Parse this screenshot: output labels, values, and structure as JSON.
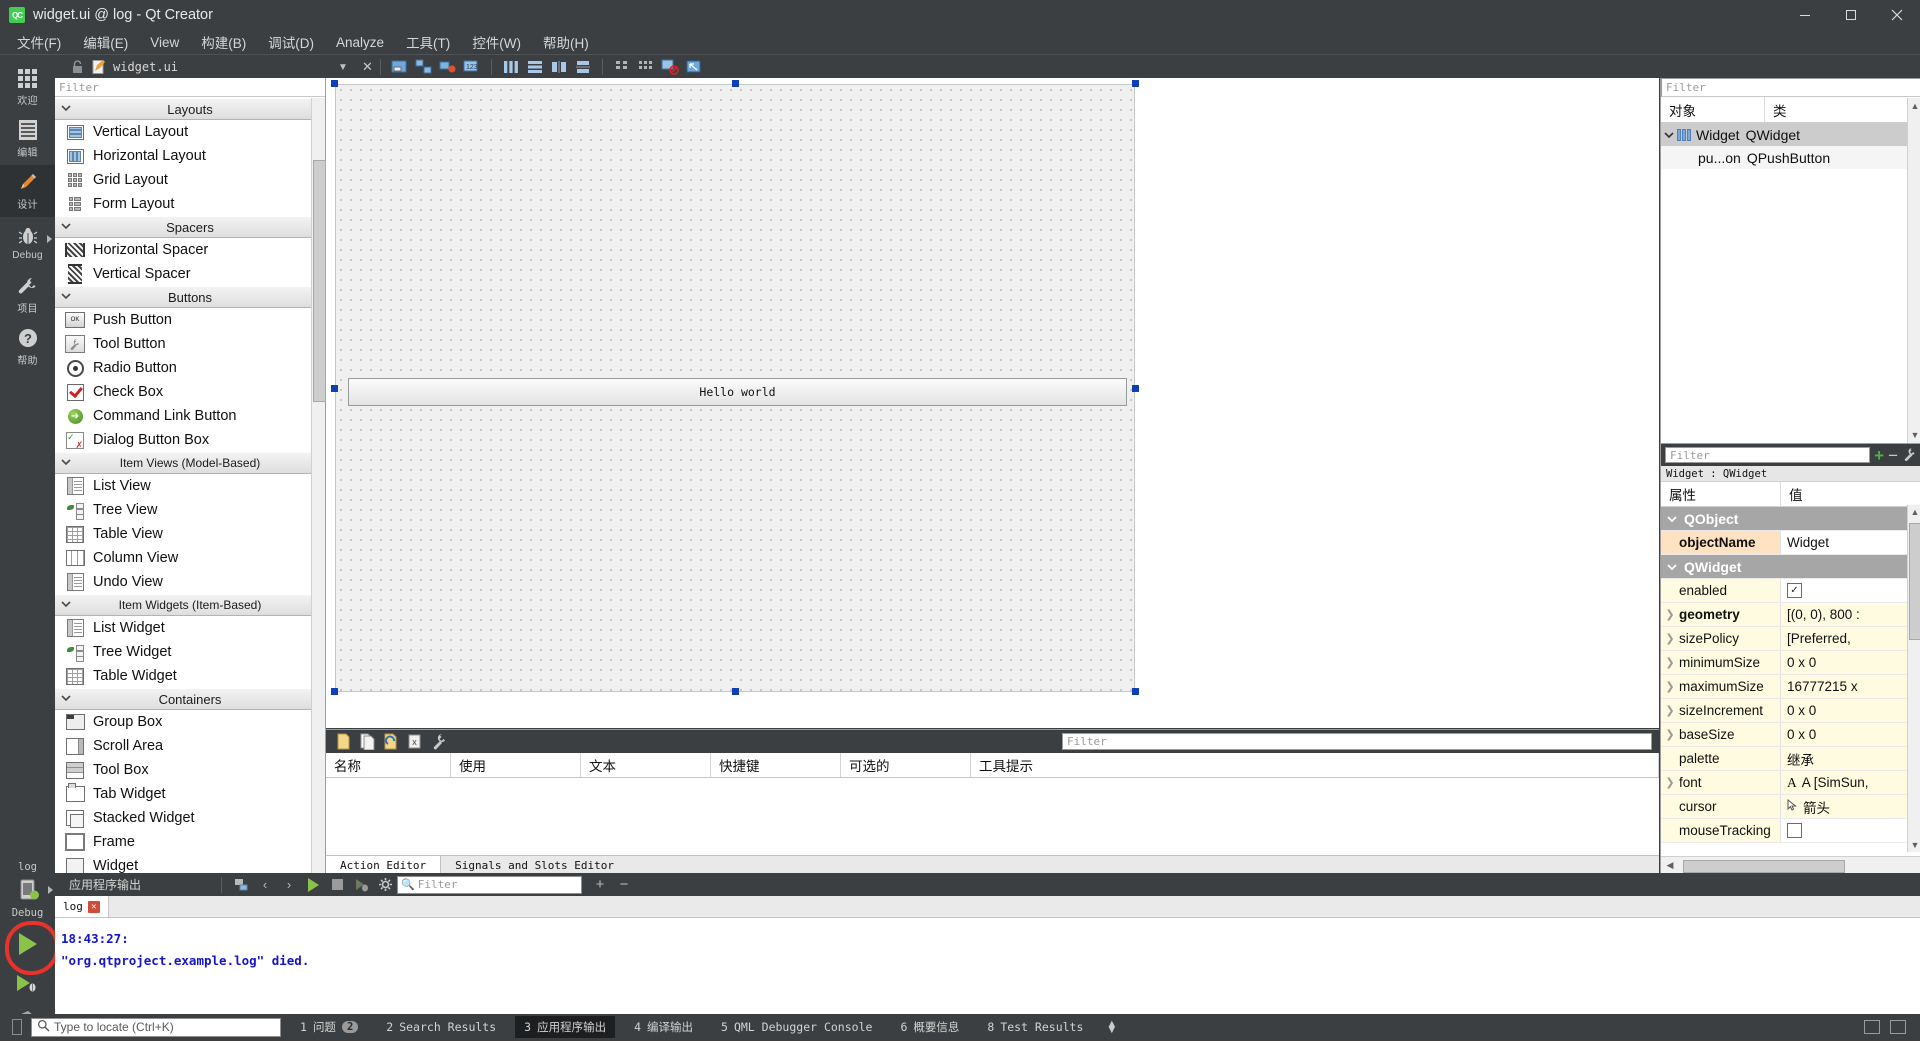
{
  "window": {
    "title": "widget.ui @ log - Qt Creator",
    "app_icon": "qt-creator-icon",
    "minimize": "—",
    "maximize": "❐",
    "close": "✕"
  },
  "menubar": [
    {
      "label": "文件(F)"
    },
    {
      "label": "编辑(E)"
    },
    {
      "label": "View"
    },
    {
      "label": "构建(B)"
    },
    {
      "label": "调试(D)"
    },
    {
      "label": "Analyze"
    },
    {
      "label": "工具(T)"
    },
    {
      "label": "控件(W)"
    },
    {
      "label": "帮助(H)"
    }
  ],
  "modebar": [
    {
      "label": "欢迎",
      "icon": "grid-icon"
    },
    {
      "label": "编辑",
      "icon": "document-icon"
    },
    {
      "label": "设计",
      "icon": "pencil-icon",
      "selected": true
    },
    {
      "label": "Debug",
      "icon": "bug-icon"
    },
    {
      "label": "项目",
      "icon": "wrench-icon"
    },
    {
      "label": "帮助",
      "icon": "question-icon"
    }
  ],
  "runbar": {
    "kit_label": "log",
    "device_label": "Debug",
    "run_button": "run-icon",
    "debug_button": "debug-run-icon",
    "build_button": "hammer-icon"
  },
  "form_toolbar": {
    "file_name": "widget.ui",
    "lock_icon": "lock-icon",
    "file_icon": "ui-file-icon",
    "dropdown_icon": "chevron-down-icon",
    "close_icon": "close-icon",
    "tools": [
      "edit-widgets-icon",
      "edit-signals-slots-icon",
      "edit-buddies-icon",
      "edit-tab-order-icon",
      "layout-horizontally-icon",
      "layout-vertically-icon",
      "layout-splitter-h-icon",
      "layout-splitter-v-icon",
      "layout-form-icon",
      "layout-grid-icon",
      "break-layout-icon",
      "adjust-size-icon"
    ]
  },
  "widget_box": {
    "filter_placeholder": "Filter",
    "groups": [
      {
        "title": "Layouts",
        "items": [
          {
            "label": "Vertical Layout",
            "icon": "vertical-layout-icon"
          },
          {
            "label": "Horizontal Layout",
            "icon": "horizontal-layout-icon"
          },
          {
            "label": "Grid Layout",
            "icon": "grid-layout-icon"
          },
          {
            "label": "Form Layout",
            "icon": "form-layout-icon"
          }
        ]
      },
      {
        "title": "Spacers",
        "items": [
          {
            "label": "Horizontal Spacer",
            "icon": "horizontal-spacer-icon"
          },
          {
            "label": "Vertical Spacer",
            "icon": "vertical-spacer-icon"
          }
        ]
      },
      {
        "title": "Buttons",
        "items": [
          {
            "label": "Push Button",
            "icon": "push-button-icon"
          },
          {
            "label": "Tool Button",
            "icon": "tool-button-icon"
          },
          {
            "label": "Radio Button",
            "icon": "radio-button-icon"
          },
          {
            "label": "Check Box",
            "icon": "check-box-icon"
          },
          {
            "label": "Command Link Button",
            "icon": "command-link-button-icon"
          },
          {
            "label": "Dialog Button Box",
            "icon": "dialog-button-box-icon"
          }
        ]
      },
      {
        "title": "Item Views (Model-Based)",
        "items": [
          {
            "label": "List View",
            "icon": "list-view-icon"
          },
          {
            "label": "Tree View",
            "icon": "tree-view-icon"
          },
          {
            "label": "Table View",
            "icon": "table-view-icon"
          },
          {
            "label": "Column View",
            "icon": "column-view-icon"
          },
          {
            "label": "Undo View",
            "icon": "undo-view-icon"
          }
        ]
      },
      {
        "title": "Item Widgets (Item-Based)",
        "items": [
          {
            "label": "List Widget",
            "icon": "list-widget-icon"
          },
          {
            "label": "Tree Widget",
            "icon": "tree-widget-icon"
          },
          {
            "label": "Table Widget",
            "icon": "table-widget-icon"
          }
        ]
      },
      {
        "title": "Containers",
        "items": [
          {
            "label": "Group Box",
            "icon": "group-box-icon"
          },
          {
            "label": "Scroll Area",
            "icon": "scroll-area-icon"
          },
          {
            "label": "Tool Box",
            "icon": "tool-box-icon"
          },
          {
            "label": "Tab Widget",
            "icon": "tab-widget-icon"
          },
          {
            "label": "Stacked Widget",
            "icon": "stacked-widget-icon"
          },
          {
            "label": "Frame",
            "icon": "frame-icon"
          },
          {
            "label": "Widget",
            "icon": "widget-icon"
          }
        ]
      }
    ]
  },
  "canvas": {
    "button_text": "Hello world"
  },
  "action_editor": {
    "toolbar_icons": [
      "new-action-icon",
      "copy-action-icon",
      "edit-action-icon",
      "delete-action-icon",
      "configure-icon"
    ],
    "filter_placeholder": "Filter",
    "columns": [
      "名称",
      "使用",
      "文本",
      "快捷键",
      "可选的",
      "工具提示"
    ],
    "tabs": [
      {
        "label": "Action Editor",
        "selected": true
      },
      {
        "label": "Signals and Slots Editor",
        "selected": false
      }
    ]
  },
  "object_inspector": {
    "filter_placeholder": "Filter",
    "columns": [
      "对象",
      "类"
    ],
    "rows": [
      {
        "object": "Widget",
        "class": "QWidget",
        "selected": true,
        "expanded": true,
        "depth": 0,
        "icon": "widget-icon"
      },
      {
        "object": "pu...on",
        "class": "QPushButton",
        "selected": false,
        "expanded": false,
        "depth": 1,
        "icon": ""
      }
    ]
  },
  "property_editor": {
    "filter_placeholder": "Filter",
    "add_icon": "plus-icon",
    "remove_icon": "minus-icon",
    "configure_icon": "wrench-icon",
    "subject": "Widget : QWidget",
    "columns": [
      "属性",
      "值"
    ],
    "rows": [
      {
        "kind": "group",
        "name": "QObject"
      },
      {
        "kind": "prop",
        "name": "objectName",
        "value": "Widget",
        "bold": true,
        "highlight": true,
        "expandable": false
      },
      {
        "kind": "group",
        "name": "QWidget"
      },
      {
        "kind": "prop",
        "name": "enabled",
        "value": "",
        "checkbox": true,
        "checked": true,
        "expandable": false
      },
      {
        "kind": "prop",
        "name": "geometry",
        "value": "[(0, 0), 800 :",
        "bold": true,
        "expandable": true
      },
      {
        "kind": "prop",
        "name": "sizePolicy",
        "value": "[Preferred,",
        "expandable": true
      },
      {
        "kind": "prop",
        "name": "minimumSize",
        "value": "0 x 0",
        "expandable": true
      },
      {
        "kind": "prop",
        "name": "maximumSize",
        "value": "16777215 x",
        "expandable": true
      },
      {
        "kind": "prop",
        "name": "sizeIncrement",
        "value": "0 x 0",
        "expandable": true
      },
      {
        "kind": "prop",
        "name": "baseSize",
        "value": "0 x 0",
        "expandable": true
      },
      {
        "kind": "prop",
        "name": "palette",
        "value": "继承",
        "expandable": false
      },
      {
        "kind": "prop",
        "name": "font",
        "value": "A  [SimSun,",
        "expandable": true
      },
      {
        "kind": "prop",
        "name": "cursor",
        "value": "箭头",
        "expandable": false
      },
      {
        "kind": "prop",
        "name": "mouseTracking",
        "value": "",
        "checkbox": true,
        "checked": false,
        "expandable": false
      }
    ]
  },
  "output_pane": {
    "title": "应用程序输出",
    "toolbar_icons": [
      "attach-icon",
      "prev-icon",
      "next-icon",
      "run-icon",
      "stop-icon",
      "rerun-icon",
      "settings-icon"
    ],
    "filter_placeholder": "Filter",
    "zoom_in": "+",
    "zoom_out": "−",
    "tabs": [
      {
        "label": "log",
        "close": "✕"
      }
    ],
    "lines": [
      "18:43:27:",
      "\"org.qtproject.example.log\" died."
    ]
  },
  "status_bar": {
    "locate_placeholder": "Type to locate (Ctrl+K)",
    "search_icon": "search-icon",
    "items": [
      {
        "num": "1",
        "label": "问题",
        "badge": "2",
        "selected": false
      },
      {
        "num": "2",
        "label": "Search Results",
        "badge": "",
        "selected": false
      },
      {
        "num": "3",
        "label": "应用程序输出",
        "badge": "",
        "selected": true
      },
      {
        "num": "4",
        "label": "编译输出",
        "badge": "",
        "selected": false
      },
      {
        "num": "5",
        "label": "QML Debugger Console",
        "badge": "",
        "selected": false
      },
      {
        "num": "6",
        "label": "概要信息",
        "badge": "",
        "selected": false
      },
      {
        "num": "8",
        "label": "Test Results",
        "badge": "",
        "selected": false
      }
    ]
  },
  "colors": {
    "chrome": "#3c3f41",
    "accent_green": "#41cd52",
    "selection": "#0f3fb4",
    "highlight_row": "#ffe2c2",
    "prop_row": "#fffbe0"
  }
}
